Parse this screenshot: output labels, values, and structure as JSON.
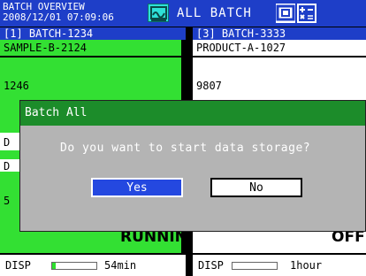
{
  "header": {
    "title_line1": "BATCH OVERVIEW",
    "title_line2": "2008/12/01 07:09:06",
    "mode": "ALL BATCH",
    "icons": [
      "memory-icon",
      "display-icon",
      "calculator-icon"
    ]
  },
  "left_panel": {
    "title": "[1] BATCH-1234",
    "product": "SAMPLE-B-2124",
    "value": "1246",
    "partial_row_a": "D",
    "partial_row_b": "D",
    "partial_row_c": "5",
    "status": "RUNNING",
    "disp_label": "DISP",
    "disp_progress": 0.08,
    "disp_time": "54min"
  },
  "right_panel": {
    "title": "[3] BATCH-3333",
    "product": "PRODUCT-A-1027",
    "value": "9807",
    "status": "OFF",
    "disp_label": "DISP",
    "disp_time": "1hour"
  },
  "dialog": {
    "title": "Batch All",
    "message": "Do you want to start data storage?",
    "yes_label": "Yes",
    "no_label": "No"
  },
  "colors": {
    "header_bg": "#1e3ec8",
    "running_bg": "#33e033",
    "dialog_title_bg": "#1c8c2a",
    "dialog_bg": "#b4b4b4",
    "selected_button": "#2448e0"
  }
}
